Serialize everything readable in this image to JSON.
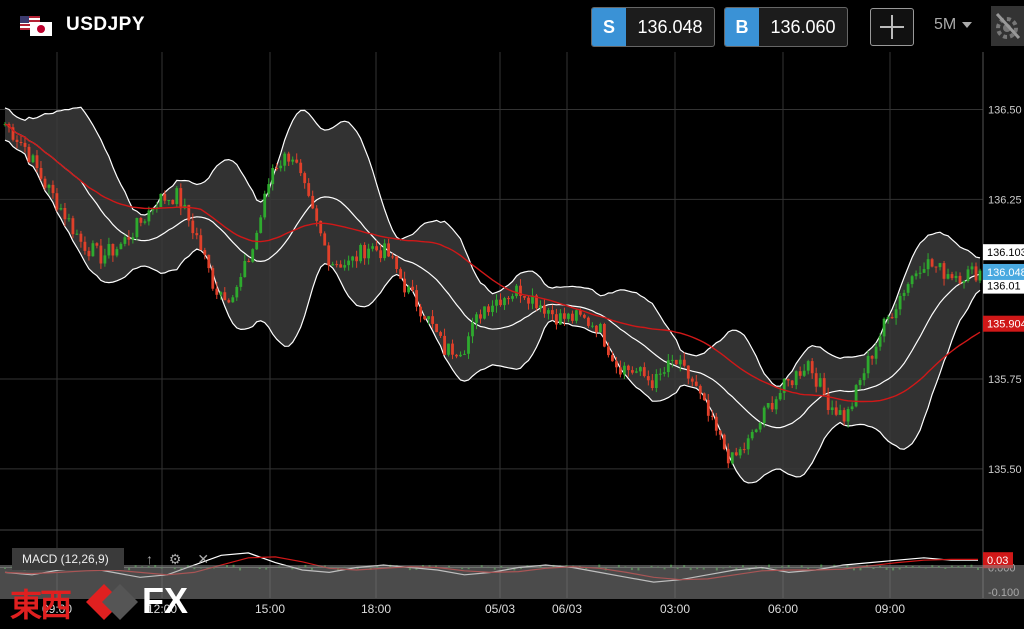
{
  "header": {
    "symbol": "USDJPY",
    "flag_icon": "us-jp-flag-icon",
    "sell": {
      "tag": "S",
      "price": "136.048"
    },
    "buy": {
      "tag": "B",
      "price": "136.060"
    },
    "timeframe": "5M"
  },
  "chart_data": {
    "type": "candlestick",
    "x_ticks": [
      "09:00",
      "12:00",
      "15:00",
      "18:00",
      "05/03",
      "06/03",
      "03:00",
      "06:00",
      "09:00"
    ],
    "price_ticks": [
      "136.50",
      "136.25",
      "135.75",
      "135.50"
    ],
    "price_ylim": [
      135.33,
      136.66
    ],
    "price_labels": {
      "bb_upper": "136.103",
      "bid": "136.048",
      "bb_mid": "136.01",
      "sma": "135.904"
    },
    "colors": {
      "up": "#2eaa2e",
      "down": "#e0402a",
      "band": "#ffffff",
      "band_fill": "#3b3b3b",
      "sma": "#d01818",
      "bid_label": "#49a9e0"
    },
    "overlays": [
      "Bollinger Bands",
      "SMA (red)"
    ],
    "close_path": [
      136.46,
      136.4,
      136.3,
      136.22,
      136.13,
      136.09,
      136.12,
      136.18,
      136.25,
      136.26,
      136.15,
      136.0,
      135.98,
      136.12,
      136.34,
      136.38,
      136.22,
      136.08,
      136.07,
      136.12,
      136.1,
      136.0,
      135.93,
      135.83,
      135.84,
      135.95,
      135.98,
      136.0,
      135.96,
      135.92,
      135.92,
      135.9,
      135.79,
      135.77,
      135.74,
      135.8,
      135.74,
      135.62,
      135.52,
      135.58,
      135.68,
      135.74,
      135.8,
      135.69,
      135.64,
      135.78,
      135.9,
      136.0,
      136.08,
      136.05,
      136.04,
      136.05
    ],
    "macd": {
      "label": "MACD (12,26,9)",
      "ticks": [
        "0.000",
        "-0.100"
      ],
      "ylim": [
        -0.125,
        0.08
      ],
      "value_label": "0.03",
      "values": [
        -0.02,
        -0.03,
        -0.01,
        0.0,
        -0.02,
        -0.04,
        -0.03,
        0.01,
        0.05,
        0.06,
        0.02,
        -0.01,
        -0.02,
        0.0,
        0.01,
        0.0,
        -0.01,
        -0.03,
        -0.02,
        0.0,
        0.01,
        0.0,
        -0.02,
        -0.04,
        -0.06,
        -0.05,
        -0.03,
        -0.01,
        0.0,
        -0.02,
        -0.01,
        0.01,
        0.02,
        0.03,
        0.04,
        0.03,
        0.03
      ]
    }
  },
  "tools": {
    "up_arrow": "↑",
    "gear": "⚙",
    "close": "✕"
  },
  "logo": {
    "text": "東西",
    "fx": "FX"
  }
}
